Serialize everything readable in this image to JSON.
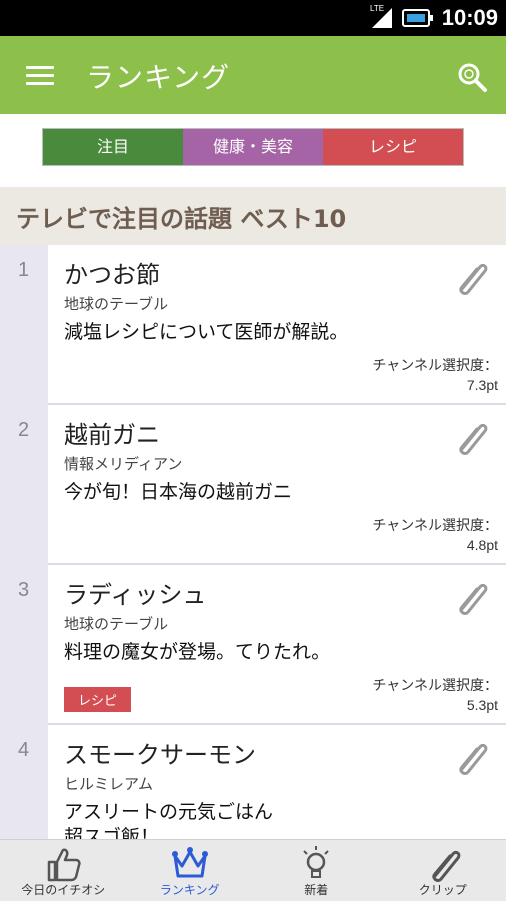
{
  "status_bar": {
    "network": "LTE",
    "time": "10:09"
  },
  "app_bar": {
    "title": "ランキング"
  },
  "tabs": [
    {
      "label": "注目",
      "color": "#4a8a3c"
    },
    {
      "label": "健康・美容",
      "color": "#a464a6"
    },
    {
      "label": "レシピ",
      "color": "#d24e52"
    }
  ],
  "section": {
    "title": "テレビで注目の話題 ベスト10"
  },
  "items": [
    {
      "rank": "1",
      "name": "かつお節",
      "program": "地球のテーブル",
      "desc": "減塩レシピについて医師が解説。",
      "desc2": "",
      "tag": "",
      "channel_label": "チャンネル選択度：",
      "channel_value": "7.3pt"
    },
    {
      "rank": "2",
      "name": "越前ガニ",
      "program": "情報メリディアン",
      "desc": "今が旬！日本海の越前ガニ",
      "desc2": "",
      "tag": "",
      "channel_label": "チャンネル選択度：",
      "channel_value": "4.8pt"
    },
    {
      "rank": "3",
      "name": "ラディッシュ",
      "program": "地球のテーブル",
      "desc": "料理の魔女が登場。てりたれ。",
      "desc2": "",
      "tag": "レシピ",
      "channel_label": "チャンネル選択度：",
      "channel_value": "5.3pt"
    },
    {
      "rank": "4",
      "name": "スモークサーモン",
      "program": "ヒルミレアム",
      "desc": "アスリートの元気ごはん",
      "desc2": "超スゴ飯！",
      "tag": "",
      "channel_label": "",
      "channel_value": ""
    }
  ],
  "bottom_nav": [
    {
      "label": "今日のイチオシ",
      "icon": "thumbs-up-icon",
      "active": false
    },
    {
      "label": "ランキング",
      "icon": "crown-icon",
      "active": true
    },
    {
      "label": "新着",
      "icon": "lightbulb-icon",
      "active": false
    },
    {
      "label": "クリップ",
      "icon": "paperclip-icon",
      "active": false
    }
  ],
  "colors": {
    "app_bar": "#8cc04a",
    "active_nav": "#2d5bd6"
  }
}
